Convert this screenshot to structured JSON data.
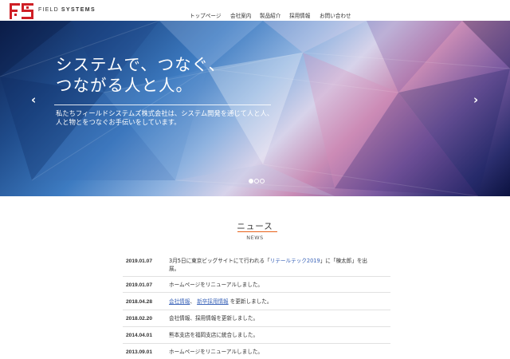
{
  "brand": {
    "name_light": "FIELD",
    "name_bold": "SYSTEMS"
  },
  "nav": {
    "items": [
      "トップページ",
      "会社案内",
      "製品紹介",
      "採用情報",
      "お問い合わせ"
    ]
  },
  "hero": {
    "headline_line1": "システムで、つなぐ、",
    "headline_line2": "つながる人と人。",
    "sub_line1": "私たちフィールドシステムズ株式会社は、システム開発を通じて人と人、",
    "sub_line2": "人と物とをつなぐお手伝いをしています。",
    "prev_arrow": "‹",
    "next_arrow": "›",
    "slides": 3,
    "active_slide": 1
  },
  "news": {
    "title": "ニュース",
    "subtitle": "NEWS",
    "accent_color": "#e8611a",
    "items": [
      {
        "date": "2019.01.07",
        "before": "3月5日に東京ビッグサイトにて行われる「",
        "link": "リテールテック2019",
        "after": "」に「棟太郎」を出",
        "line2": "展。"
      },
      {
        "date": "2019.01.07",
        "text": "ホームページをリニューアルしました。"
      },
      {
        "date": "2018.04.28",
        "link1": "会社情報",
        "sep": "、",
        "link2": "新卒採用情報",
        "after": "を更新しました。"
      },
      {
        "date": "2018.02.20",
        "text": "会社情報、採用情報を更新しました。"
      },
      {
        "date": "2014.04.01",
        "text": "熊本支店を福岡支店に統合しました。"
      },
      {
        "date": "2013.09.01",
        "text": "ホームページをリニューアルしました。"
      }
    ]
  }
}
